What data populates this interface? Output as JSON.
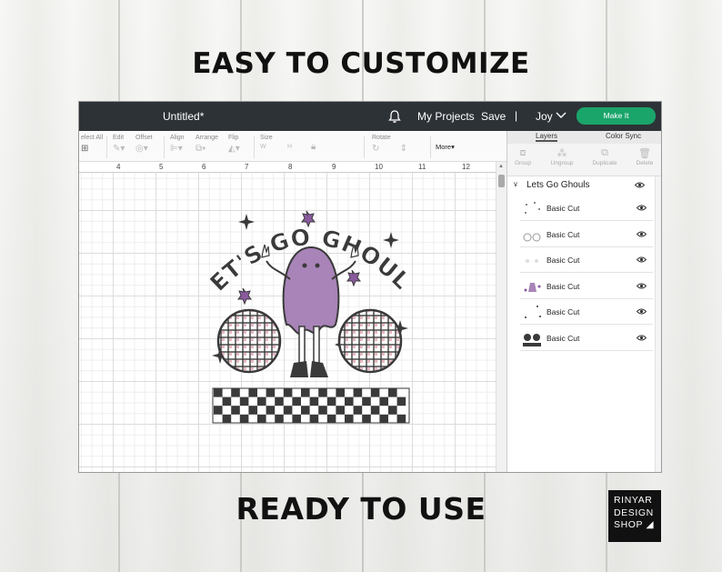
{
  "headline_top": "EASY TO CUSTOMIZE",
  "headline_bottom": "READY TO USE",
  "app": {
    "title": "Untitled*",
    "my_projects": "My Projects",
    "save": "Save",
    "separator": "|",
    "user": "Joy",
    "make_it": "Make It"
  },
  "toolbar": {
    "select_all": "elect All",
    "edit": "Edit",
    "offset": "Offset",
    "align": "Align",
    "arrange": "Arrange",
    "flip": "Flip",
    "size": "Size",
    "size_w": "W",
    "size_h": "H",
    "rotate": "Rotate",
    "more": "More"
  },
  "ruler": [
    "4",
    "5",
    "6",
    "7",
    "8",
    "9",
    "10",
    "11",
    "12"
  ],
  "panel": {
    "tabs": [
      "Layers",
      "Color Sync"
    ],
    "actions": [
      "Group",
      "Ungroup",
      "Duplicate",
      "Delete"
    ],
    "group_name": "Lets Go Ghouls",
    "layers": [
      {
        "label": "Basic Cut"
      },
      {
        "label": "Basic Cut"
      },
      {
        "label": "Basic Cut"
      },
      {
        "label": "Basic Cut"
      },
      {
        "label": "Basic Cut"
      },
      {
        "label": "Basic Cut"
      }
    ]
  },
  "design": {
    "text": "LET'S GO GHOULS",
    "colors": {
      "ghost": "#a884b8",
      "dark": "#3a3a3a",
      "accent": "#8a5a9e",
      "pink": "#e8b8c0"
    }
  },
  "logo": [
    "RINYAR",
    "DESIGN",
    "SHOP ◢"
  ],
  "colors": {
    "topbar": "#2d3237",
    "make_it": "#1aa56a"
  }
}
